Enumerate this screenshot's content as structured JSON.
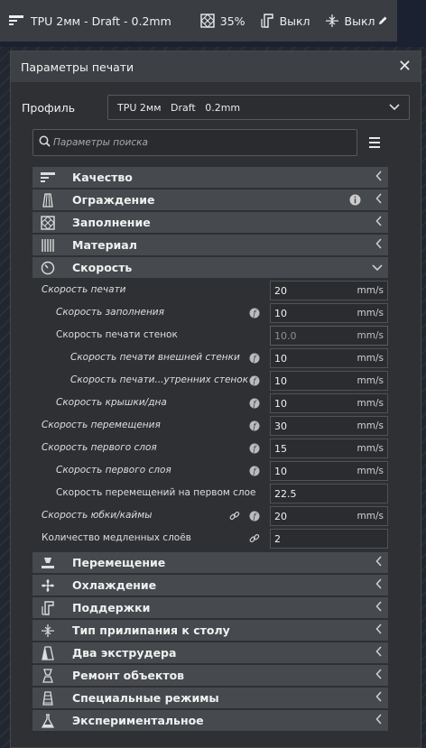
{
  "topbar": {
    "profile_summary": "TPU 2мм - Draft - 0.2mm",
    "infill": "35%",
    "support": "Выкл",
    "adhesion": "Выкл"
  },
  "panel": {
    "title": "Параметры печати",
    "profile_label": "Профиль",
    "profile_value": "TPU 2мм   Draft   0.2mm",
    "search_placeholder": "Параметры поиска"
  },
  "categories_top": [
    {
      "label": "Качество",
      "icon": "quality-icon"
    },
    {
      "label": "Ограждение",
      "icon": "shell-icon"
    },
    {
      "label": "Заполнение",
      "icon": "infill-icon"
    },
    {
      "label": "Материал",
      "icon": "material-icon"
    },
    {
      "label": "Скорость",
      "icon": "speed-icon",
      "expanded": true
    }
  ],
  "speed_settings": [
    {
      "label": "Скорость печати",
      "value": "20",
      "unit": "mm/s"
    },
    {
      "label": "Скорость заполнения",
      "value": "10",
      "unit": "mm/s"
    },
    {
      "label": "Скорость печати стенок",
      "value": "10.0",
      "unit": "mm/s"
    },
    {
      "label": "Скорость печати внешней стенки",
      "value": "10",
      "unit": "mm/s"
    },
    {
      "label": "Скорость печати...утренних стенок",
      "value": "10",
      "unit": "mm/s"
    },
    {
      "label": "Скорость крышки/дна",
      "value": "10",
      "unit": "mm/s"
    },
    {
      "label": "Скорость перемещения",
      "value": "30",
      "unit": "mm/s"
    },
    {
      "label": "Скорость первого слоя",
      "value": "15",
      "unit": "mm/s"
    },
    {
      "label": "Скорость первого слоя",
      "value": "10",
      "unit": "mm/s"
    },
    {
      "label": "Скорость перемещений на первом слое",
      "value": "22.5",
      "unit": ""
    },
    {
      "label": "Скорость юбки/каймы",
      "value": "20",
      "unit": "mm/s"
    },
    {
      "label": "Количество медленных слоёв",
      "value": "2",
      "unit": ""
    }
  ],
  "categories_bottom": [
    {
      "label": "Перемещение",
      "icon": "travel-icon"
    },
    {
      "label": "Охлаждение",
      "icon": "cooling-icon"
    },
    {
      "label": "Поддержки",
      "icon": "support-icon"
    },
    {
      "label": "Тип прилипания к столу",
      "icon": "adhesion-icon"
    },
    {
      "label": "Два экструдера",
      "icon": "dual-extrusion-icon"
    },
    {
      "label": "Ремонт объектов",
      "icon": "mesh-fixes-icon"
    },
    {
      "label": "Специальные режимы",
      "icon": "special-modes-icon"
    },
    {
      "label": "Экспериментальное",
      "icon": "experimental-icon"
    }
  ],
  "colors": {
    "panel_bg": "#2e3033",
    "category_bg": "#46494d",
    "field_bg": "#2a2c2f"
  }
}
